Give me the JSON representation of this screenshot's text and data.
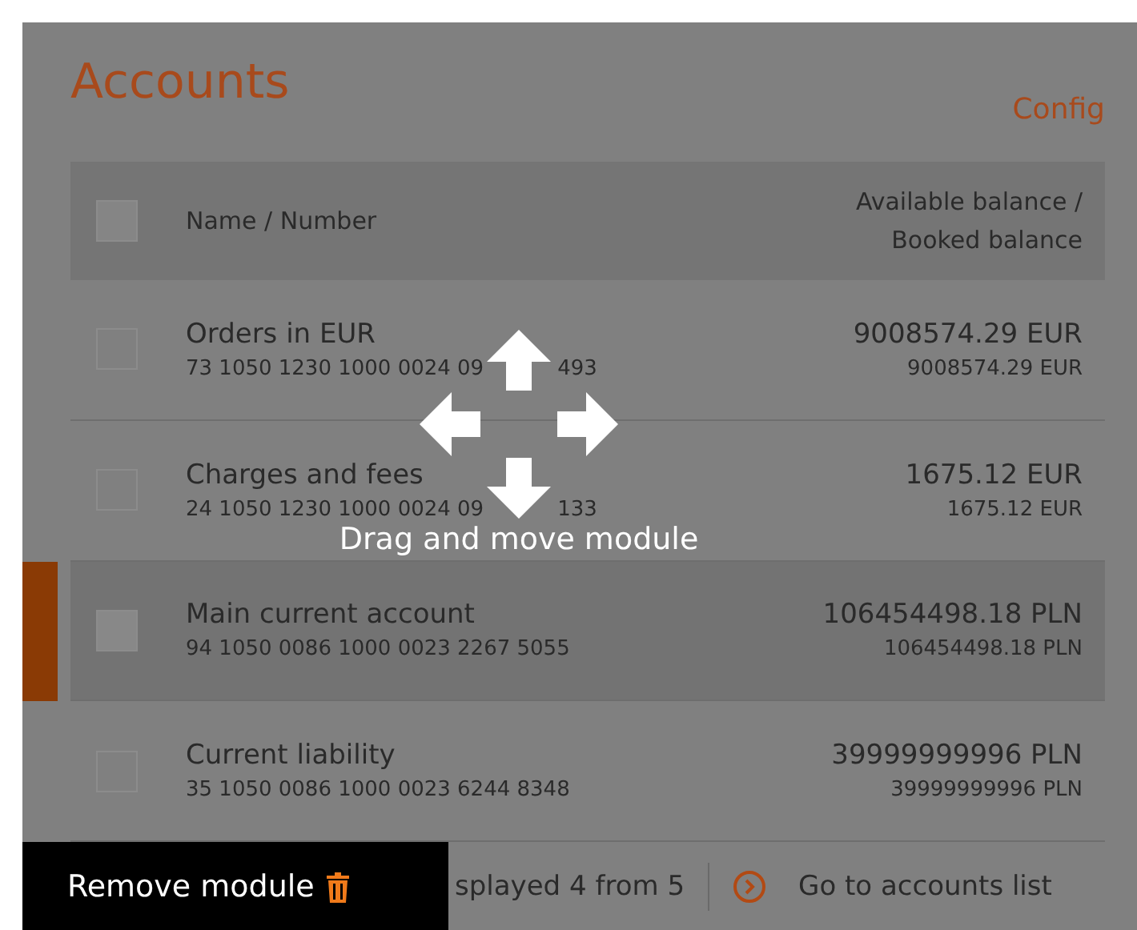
{
  "module": {
    "title": "Accounts",
    "config_link": "Config"
  },
  "select_all": {
    "checked": false
  },
  "table": {
    "columns": [
      "Name / Number",
      "Available balance /",
      "Booked balance"
    ],
    "rows": [
      {
        "name": "Orders in EUR",
        "number": "73 1050 1230 1000 0024 09",
        "number_end": "493",
        "available": "9008574.29 EUR",
        "booked": "9008574.29 EUR",
        "selected": false
      },
      {
        "name": "Charges and fees",
        "number": "24 1050 1230 1000 0024 09",
        "number_end": "133",
        "available": "1675.12 EUR",
        "booked": "1675.12 EUR",
        "selected": false
      },
      {
        "name": "Main current account",
        "number": "94 1050 0086 1000 0023 2267 5055",
        "available": "106454498.18 PLN",
        "booked": "106454498.18 PLN",
        "selected": true
      },
      {
        "name": "Current liability",
        "number": "35 1050 0086 1000 0023 6244 8348",
        "available": "39999999996 PLN",
        "booked": "39999999996 PLN",
        "selected": false
      }
    ]
  },
  "footer": {
    "count": "splayed 4 from 5",
    "link": "Go to accounts list"
  },
  "drag_hint": "Drag and move module",
  "remove_button": "Remove module"
}
